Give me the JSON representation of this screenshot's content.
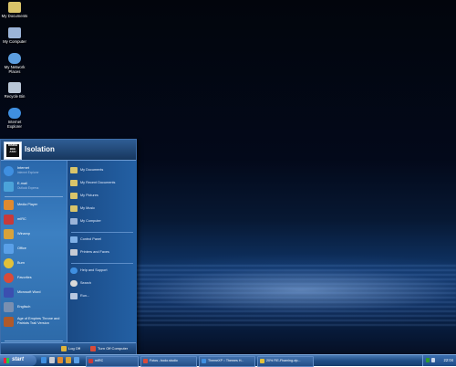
{
  "desktop": {
    "icons": [
      {
        "label": "My Documents",
        "color": "#d9c46a"
      },
      {
        "label": "My Computer",
        "color": "#9bb4d8"
      },
      {
        "label": "My Network Places",
        "color": "#5c9ee0"
      },
      {
        "label": "Recycle Bin",
        "color": "#b9c6d6"
      },
      {
        "label": "Internet Explorer",
        "color": "#3f8fe0"
      }
    ]
  },
  "start_menu": {
    "user_name": "Isolation",
    "avatar_text": [
      "RISING",
      "BEE",
      "ASS!"
    ],
    "pinned": [
      {
        "title": "Internet",
        "sub": "Internet Explorer",
        "color": "#3f8fe0"
      },
      {
        "title": "E-mail",
        "sub": "Outlook Express",
        "color": "#4ba3d9"
      }
    ],
    "recent": [
      {
        "title": "Media Player",
        "color": "#e08a2f"
      },
      {
        "title": "mIRC",
        "color": "#c83a3a"
      },
      {
        "title": "Winamp",
        "color": "#d7a23a"
      },
      {
        "title": "Office",
        "color": "#5aa0e8"
      },
      {
        "title": "Burn",
        "color": "#e2c13a"
      },
      {
        "title": "Favorites",
        "color": "#d84b3a"
      },
      {
        "title": "Microsoft Word",
        "color": "#3b4fb0"
      },
      {
        "title": "Englisch",
        "color": "#7a8fb0"
      },
      {
        "title": "Age of Empires Throne and Patriots Trail Version",
        "color": "#b05a2a"
      }
    ],
    "all_programs": "All Programs",
    "right_items": [
      {
        "label": "My Documents",
        "color": "#d9c46a"
      },
      {
        "label": "My Recent Documents",
        "color": "#d9c46a"
      },
      {
        "label": "My Pictures",
        "color": "#d9c46a"
      },
      {
        "label": "My Music",
        "color": "#d9c46a"
      },
      {
        "label": "My Computer",
        "color": "#9bb4d8"
      },
      {
        "label": "Control Panel",
        "color": "#7fb0e6"
      },
      {
        "label": "Printers and Faxes",
        "color": "#c7cbd4"
      },
      {
        "label": "Help and Support",
        "color": "#3f8fe0"
      },
      {
        "label": "Search",
        "color": "#d9d9d9"
      },
      {
        "label": "Run...",
        "color": "#b8c8e0"
      }
    ],
    "log_off": "Log Off",
    "turn_off": "Turn Off Computer"
  },
  "taskbar": {
    "start_label": "start",
    "buttons": [
      {
        "label": "mIRC",
        "color": "#c83a3a"
      },
      {
        "label": "Fotos - bodo.studio",
        "color": "#d84b3a"
      },
      {
        "label": "ThemeXP :: Themes H...",
        "color": "#3f8fe0"
      },
      {
        "label": "20% FIE-Fhaming.zip...",
        "color": "#e2c13a"
      }
    ],
    "clock": "22:04"
  }
}
